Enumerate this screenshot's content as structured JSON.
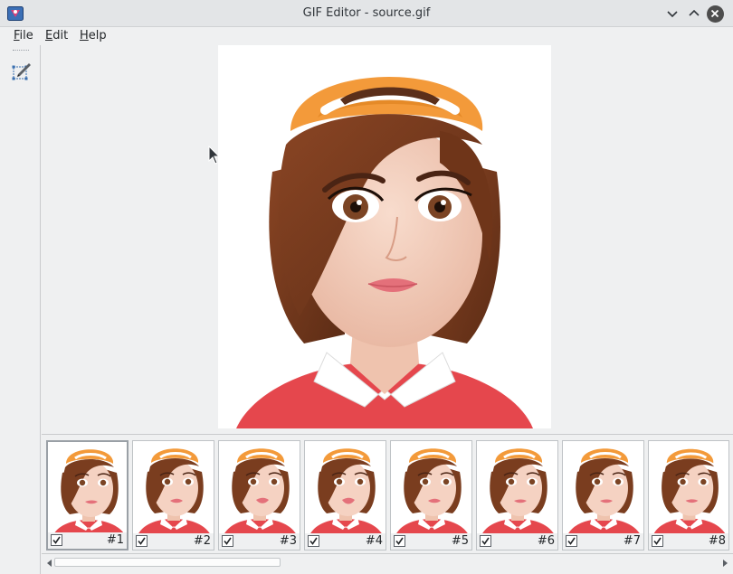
{
  "window": {
    "title": "GIF Editor - source.gif"
  },
  "menu": [
    {
      "accel": "F",
      "rest": "ile"
    },
    {
      "accel": "E",
      "rest": "dit"
    },
    {
      "accel": "H",
      "rest": "elp"
    }
  ],
  "toolbar": {
    "tools": [
      "crop-icon"
    ]
  },
  "frames": [
    {
      "label": "#1",
      "checked": true,
      "selected": true
    },
    {
      "label": "#2",
      "checked": true
    },
    {
      "label": "#3",
      "checked": true
    },
    {
      "label": "#4",
      "checked": true
    },
    {
      "label": "#5",
      "checked": true
    },
    {
      "label": "#6",
      "checked": true
    },
    {
      "label": "#7",
      "checked": true
    },
    {
      "label": "#8",
      "checked": true
    }
  ],
  "colors": {
    "accent": "#3daee9",
    "hat": "#f39a3a",
    "hair": "#7a3d1f",
    "skin": "#f3cdbb",
    "shirt": "#e5474d"
  }
}
